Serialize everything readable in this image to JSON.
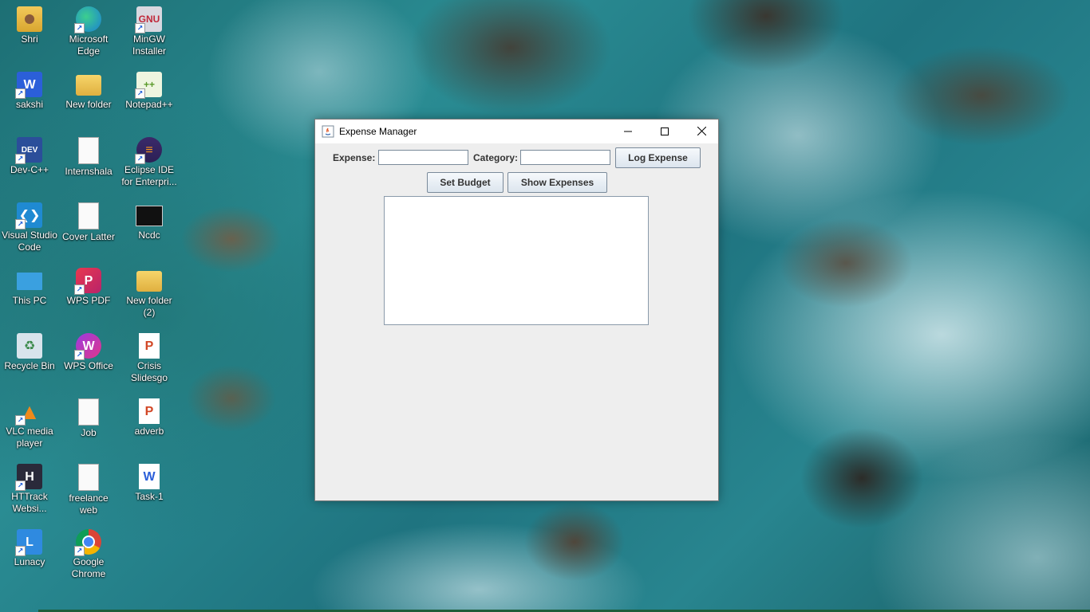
{
  "desktop": {
    "icons": [
      {
        "label": "Shri",
        "icon": "user-folder-icon"
      },
      {
        "label": "Microsoft Edge",
        "icon": "edge-icon"
      },
      {
        "label": "MinGW Installer",
        "icon": "mingw-icon"
      },
      {
        "label": "sakshi",
        "icon": "word-doc-icon"
      },
      {
        "label": "New folder",
        "icon": "folder-icon"
      },
      {
        "label": "Notepad++",
        "icon": "notepadpp-icon"
      },
      {
        "label": "Dev-C++",
        "icon": "devcpp-icon"
      },
      {
        "label": "Internshala",
        "icon": "text-file-icon"
      },
      {
        "label": "Eclipse IDE for Enterpri...",
        "icon": "eclipse-icon"
      },
      {
        "label": "Visual Studio Code",
        "icon": "vscode-icon"
      },
      {
        "label": "Cover Latter",
        "icon": "text-file-icon"
      },
      {
        "label": "Ncdc",
        "icon": "image-file-icon"
      },
      {
        "label": "This PC",
        "icon": "computer-icon"
      },
      {
        "label": "WPS PDF",
        "icon": "wps-pdf-icon"
      },
      {
        "label": "New folder (2)",
        "icon": "folder-icon"
      },
      {
        "label": "Recycle Bin",
        "icon": "recycle-bin-icon"
      },
      {
        "label": "WPS Office",
        "icon": "wps-office-icon"
      },
      {
        "label": "Crisis Slidesgo",
        "icon": "powerpoint-icon"
      },
      {
        "label": "VLC media player",
        "icon": "vlc-icon"
      },
      {
        "label": "Job",
        "icon": "text-file-icon"
      },
      {
        "label": "adverb",
        "icon": "powerpoint-icon"
      },
      {
        "label": "HTTrack Websi...",
        "icon": "httrack-icon"
      },
      {
        "label": "freelance web",
        "icon": "text-file-icon"
      },
      {
        "label": "Task-1",
        "icon": "word-doc-icon"
      },
      {
        "label": "Lunacy",
        "icon": "lunacy-icon"
      },
      {
        "label": "Google Chrome",
        "icon": "chrome-icon"
      }
    ]
  },
  "window": {
    "title": "Expense Manager",
    "form": {
      "expense_label": "Expense:",
      "expense_value": "",
      "category_label": "Category:",
      "category_value": "",
      "log_button": "Log Expense",
      "budget_button": "Set Budget",
      "show_button": "Show Expenses"
    },
    "output_text": ""
  },
  "colors": {
    "window_bg": "#eeeeee",
    "titlebar_bg": "#ffffff",
    "button_border": "#7a8a9a"
  }
}
